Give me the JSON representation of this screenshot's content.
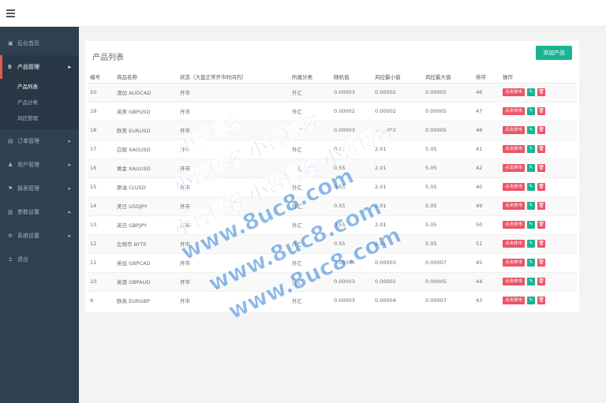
{
  "sidebar": {
    "items": [
      {
        "icon": "home-icon",
        "glyph": "▣",
        "label": "后台首页",
        "arrow": ""
      },
      {
        "icon": "product-icon",
        "glyph": "B",
        "label": "产品管理",
        "arrow": "▸"
      },
      {
        "icon": "order-icon",
        "glyph": "▤",
        "label": "订单管理",
        "arrow": "▸"
      },
      {
        "icon": "user-icon",
        "glyph": "♟",
        "label": "用户管理",
        "arrow": "▸"
      },
      {
        "icon": "report-icon",
        "glyph": "⚑",
        "label": "报表管理",
        "arrow": "▸"
      },
      {
        "icon": "params-icon",
        "glyph": "▥",
        "label": "参数设置",
        "arrow": "▸"
      },
      {
        "icon": "system-icon",
        "glyph": "✲",
        "label": "系统设置",
        "arrow": "▸"
      },
      {
        "icon": "logout-icon",
        "glyph": "➲",
        "label": "退出",
        "arrow": ""
      }
    ],
    "submenu": [
      "产品列表",
      "产品分类",
      "风控管理"
    ]
  },
  "panel": {
    "title": "产品列表",
    "add_label": "添加产品"
  },
  "table": {
    "headers": [
      "编号",
      "商品名称",
      "状态（大盘正常开市时间内）",
      "所属分类",
      "随机值",
      "风控最小值",
      "风控最大值",
      "排序",
      "操作"
    ],
    "rows": [
      [
        "20",
        "澳加 AUDCAD",
        "开市",
        "外汇",
        "0.00003",
        "0.00002",
        "0.00005",
        "46"
      ],
      [
        "19",
        "英美 GBPUSD",
        "开市",
        "外汇",
        "0.00002",
        "0.00002",
        "0.00005",
        "47"
      ],
      [
        "18",
        "欧美 EURUSD",
        "开市",
        "外汇",
        "0.00003",
        "0.00002",
        "0.00005",
        "48"
      ],
      [
        "17",
        "白银 XAGUSD",
        "开市",
        "外汇",
        "0.55",
        "2.01",
        "5.05",
        "41"
      ],
      [
        "16",
        "黄金 XAUUSD",
        "开市",
        "外汇",
        "0.55",
        "2.01",
        "5.05",
        "42"
      ],
      [
        "15",
        "原油 CLUSD",
        "开市",
        "外汇",
        "0.55",
        "2.01",
        "5.05",
        "40"
      ],
      [
        "14",
        "美日 USDJPY",
        "开市",
        "外汇",
        "0.55",
        "2.01",
        "5.05",
        "49"
      ],
      [
        "13",
        "英日 GBPJPY",
        "开市",
        "外汇",
        "0.55",
        "2.01",
        "5.05",
        "50"
      ],
      [
        "12",
        "比特币 BYTE",
        "开市",
        "外汇",
        "0.55",
        "2.01",
        "5.05",
        "51"
      ],
      [
        "11",
        "英加 GBPCAD",
        "开市",
        "外汇",
        "0.00004",
        "0.00003",
        "0.00007",
        "45"
      ],
      [
        "10",
        "英澳 GBPAUD",
        "开市",
        "外汇",
        "0.00003",
        "0.00002",
        "0.00005",
        "44"
      ],
      [
        "9",
        "欧英 EURGBP",
        "开市",
        "外汇",
        "0.00003",
        "0.00004",
        "0.00007",
        "43"
      ]
    ],
    "action_label": "点击休市",
    "edit_glyph": "✎",
    "delete_glyph": "🗑"
  },
  "watermark": {
    "lines": [
      "小哲博客",
      "小哲博客 小哲博客",
      "小哲博客 小哲博客 小哲博客",
      "www.8uc8.com",
      "www.8uc8.com",
      "www.8uc8.com"
    ],
    "color": "#2f7fd6"
  }
}
